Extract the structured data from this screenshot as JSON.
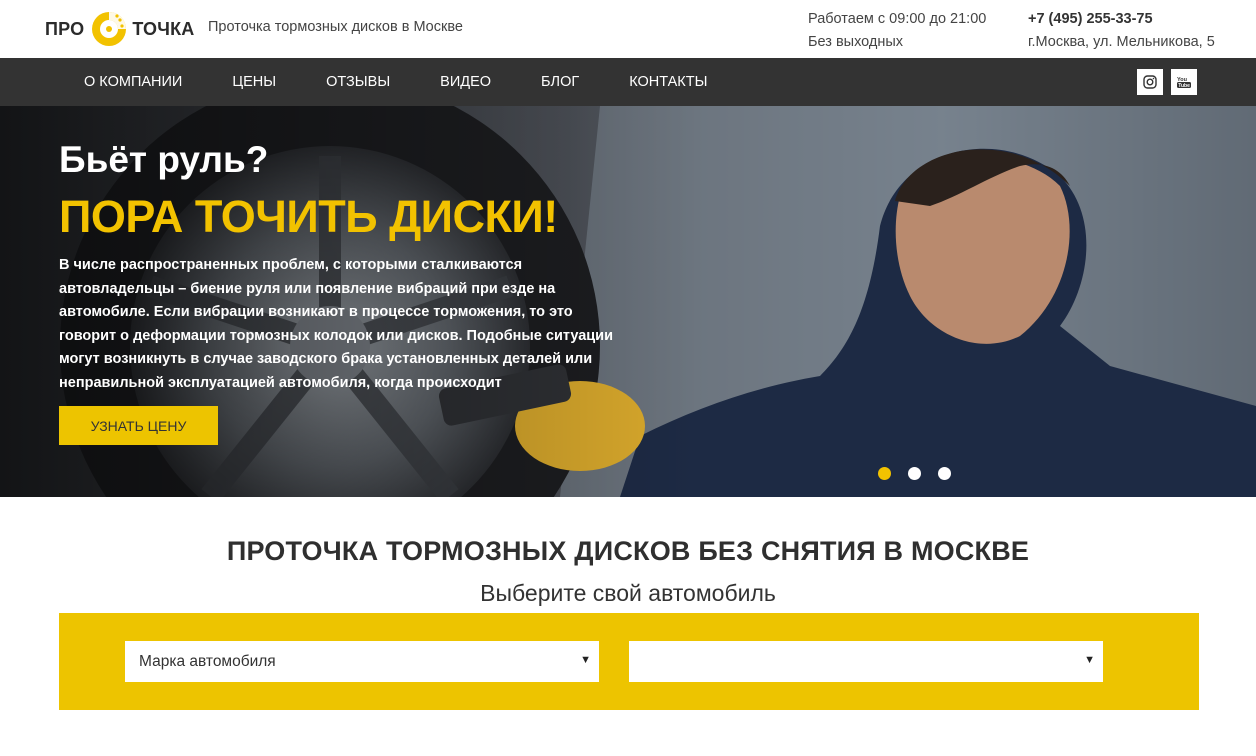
{
  "header": {
    "logo_left": "ПРО",
    "logo_right": "ТОЧКА",
    "tagline": "Проточка тормозных дисков в Москве",
    "hours_line1": "Работаем с 09:00 до 21:00",
    "hours_line2": "Без выходных",
    "phone": "+7 (495) 255-33-75",
    "address": "г.Москва, ул. Мельникова, 5"
  },
  "nav": {
    "items": [
      "О КОМПАНИИ",
      "ЦЕНЫ",
      "ОТЗЫВЫ",
      "ВИДЕО",
      "БЛОГ",
      "КОНТАКТЫ"
    ],
    "socials": [
      "instagram-icon",
      "youtube-icon"
    ]
  },
  "hero": {
    "question": "Бьёт руль?",
    "title": "ПОРА ТОЧИТЬ ДИСКИ!",
    "text": "В числе распространенных проблем, с которыми сталкиваются автовладельцы – биение руля или появление вибраций при езде на автомобиле. Если вибрации возникают в процессе торможения, то это говорит о деформации тормозных колодок или дисков. Подобные ситуации могут возникнуть в случае заводского брака установленных деталей или неправильной эксплуатацией автомобиля, когда происходит",
    "button": "УЗНАТЬ ЦЕНУ",
    "slides_active": 1,
    "slides_total": 3
  },
  "section": {
    "title": "ПРОТОЧКА ТОРМОЗНЫХ ДИСКОВ БЕЗ СНЯТИЯ В МОСКВЕ",
    "subtitle": "Выберите свой автомобиль",
    "select_brand": "Марка автомобиля",
    "select_model": ""
  },
  "colors": {
    "accent": "#edc400",
    "nav_bg": "#333333",
    "text": "#333333"
  }
}
